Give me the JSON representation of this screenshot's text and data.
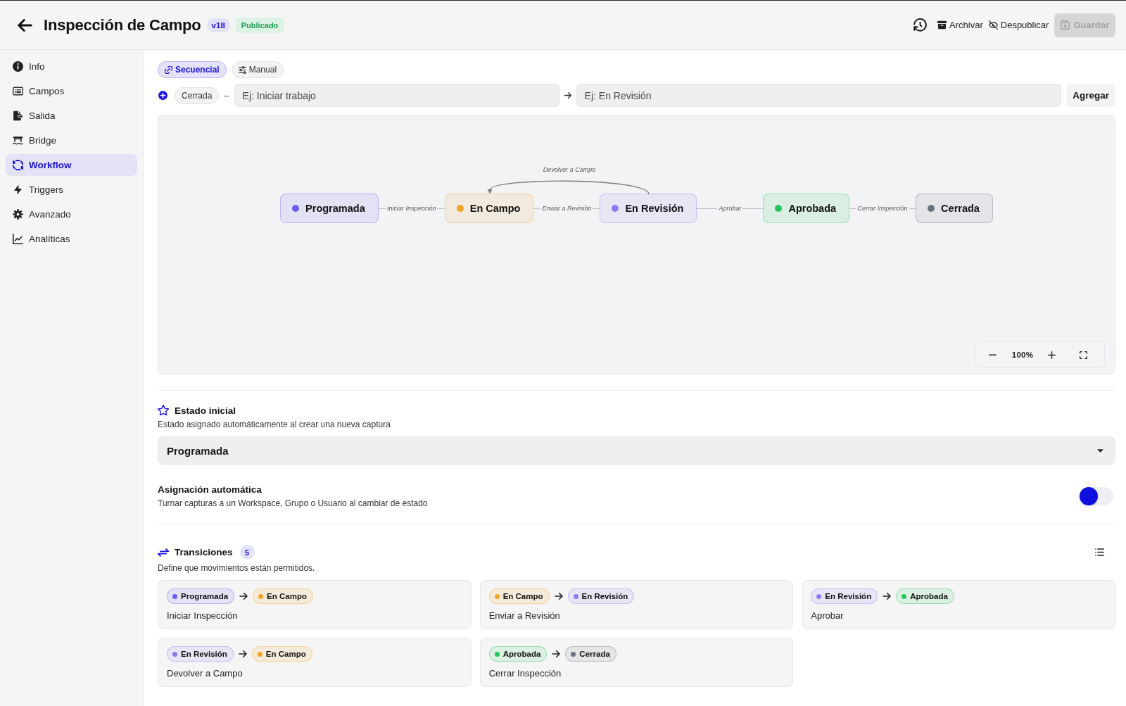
{
  "header": {
    "title": "Inspección de Campo",
    "version": "v18",
    "status": "Publicado",
    "actions": [
      {
        "kind": "history"
      },
      {
        "kind": "archive",
        "label": "Archivar"
      },
      {
        "kind": "unpublish",
        "label": "Despublicar"
      }
    ],
    "save": {
      "label": "Guardar",
      "disabled": true
    }
  },
  "sidebar": {
    "items": [
      {
        "kind": "info",
        "label": "Info",
        "selected": false
      },
      {
        "kind": "fields",
        "label": "Campos",
        "selected": false
      },
      {
        "kind": "output",
        "label": "Salida",
        "selected": false
      },
      {
        "kind": "bridge",
        "label": "Bridge",
        "selected": false
      },
      {
        "kind": "workflow",
        "label": "Workflow",
        "selected": true
      },
      {
        "kind": "triggers",
        "label": "Triggers",
        "selected": false
      },
      {
        "kind": "advanced",
        "label": "Avanzado",
        "selected": false
      },
      {
        "kind": "analytics",
        "label": "Analíticas",
        "selected": false
      }
    ]
  },
  "modes": [
    {
      "kind": "sequential",
      "label": "Secuencial",
      "selected": true
    },
    {
      "kind": "manual",
      "label": "Manual",
      "selected": false
    }
  ],
  "add_transition": {
    "from_state": "Cerrada",
    "separator": "–",
    "name_field": {
      "placeholder": "Ej: Iniciar trabajo"
    },
    "target_field": {
      "placeholder": "Ej: En Revisión"
    },
    "button": "Agregar"
  },
  "diagram": {
    "nodes": [
      {
        "label": "Programada",
        "color": "#6c5cf5",
        "next_edge": "Iniciar Inspección"
      },
      {
        "label": "En Campo",
        "color": "#f5a524",
        "next_edge": "Enviar a Revisión"
      },
      {
        "label": "En Revisión",
        "color": "#8b7cf6",
        "next_edge": "Aprobar",
        "back_edge": "Devolver a Campo"
      },
      {
        "label": "Aprobada",
        "color": "#22c55e",
        "next_edge": "Cerrar Inspección"
      },
      {
        "label": "Cerrada",
        "color": "#6b7280"
      }
    ],
    "zoom": "100%"
  },
  "initial_state": {
    "title": "Estado inicial",
    "description": "Estado asignado automáticamente al crear una nueva captura",
    "value": "Programada"
  },
  "auto_assign": {
    "title": "Asignación automática",
    "description": "Turnar capturas a un Workspace, Grupo o Usuario al cambiar de estado",
    "on": false
  },
  "transitions": {
    "title": "Transiciones",
    "count": "5",
    "description": "Define que movimientos están permitidos.",
    "items": [
      {
        "from": {
          "label": "Programada",
          "color": "#6c5cf5"
        },
        "to": {
          "label": "En Campo",
          "color": "#f5a524"
        },
        "name": "Iniciar Inspección"
      },
      {
        "from": {
          "label": "En Campo",
          "color": "#f5a524"
        },
        "to": {
          "label": "En Revisión",
          "color": "#8b7cf6"
        },
        "name": "Enviar a Revisión"
      },
      {
        "from": {
          "label": "En Revisión",
          "color": "#8b7cf6"
        },
        "to": {
          "label": "Aprobada",
          "color": "#22c55e"
        },
        "name": "Aprobar"
      },
      {
        "from": {
          "label": "En Revisión",
          "color": "#8b7cf6"
        },
        "to": {
          "label": "En Campo",
          "color": "#f5a524"
        },
        "name": "Devolver a Campo"
      },
      {
        "from": {
          "label": "Aprobada",
          "color": "#22c55e"
        },
        "to": {
          "label": "Cerrada",
          "color": "#6b7280"
        },
        "name": "Cerrar Inspección"
      }
    ]
  }
}
